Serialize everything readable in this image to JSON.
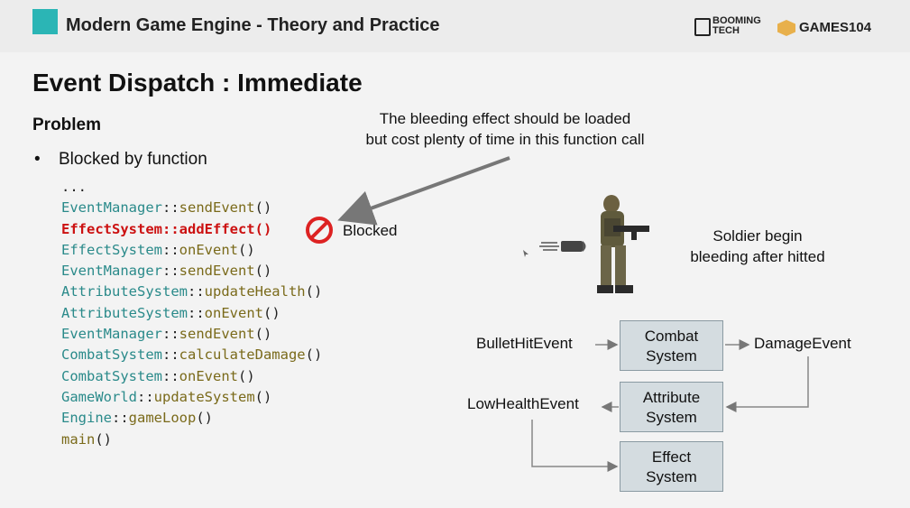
{
  "header": {
    "title": "Modern Game Engine - Theory and Practice",
    "brand_booming": "BOOMING TECH",
    "brand_games": "GAMES104"
  },
  "slide": {
    "title": "Event Dispatch : Immediate",
    "section": "Problem",
    "bullet_marker": "•",
    "bullet_text": "Blocked by function"
  },
  "code": {
    "ellipsis": "...",
    "lines": [
      {
        "cls": "EventManager",
        "sep": "::",
        "fn": "sendEvent",
        "args": "()",
        "highlight": false
      },
      {
        "cls": "EffectSystem",
        "sep": "::",
        "fn": "addEffect",
        "args": "()",
        "highlight": true
      },
      {
        "cls": "EffectSystem",
        "sep": "::",
        "fn": "onEvent",
        "args": "()",
        "highlight": false
      },
      {
        "cls": "EventManager",
        "sep": "::",
        "fn": "sendEvent",
        "args": "()",
        "highlight": false
      },
      {
        "cls": "AttributeSystem",
        "sep": "::",
        "fn": "updateHealth",
        "args": "()",
        "highlight": false
      },
      {
        "cls": "AttributeSystem",
        "sep": "::",
        "fn": "onEvent",
        "args": "()",
        "highlight": false
      },
      {
        "cls": "EventManager",
        "sep": "::",
        "fn": "sendEvent",
        "args": "()",
        "highlight": false
      },
      {
        "cls": "CombatSystem",
        "sep": "::",
        "fn": "calculateDamage",
        "args": "()",
        "highlight": false
      },
      {
        "cls": "CombatSystem",
        "sep": "::",
        "fn": "onEvent",
        "args": "()",
        "highlight": false
      },
      {
        "cls": "GameWorld",
        "sep": "::",
        "fn": "updateSystem",
        "args": "()",
        "highlight": false
      },
      {
        "cls": "Engine",
        "sep": "::",
        "fn": "gameLoop",
        "args": "()",
        "highlight": false
      },
      {
        "cls": "",
        "sep": "",
        "fn": "main",
        "args": "()",
        "highlight": false
      }
    ]
  },
  "blocked_label": "Blocked",
  "callout": {
    "line1": "The bleeding effect should be loaded",
    "line2": "but cost plenty of time in this function call"
  },
  "soldier_caption": {
    "line1": "Soldier begin",
    "line2": "bleeding after hitted"
  },
  "diagram": {
    "events": {
      "hit": "BulletHitEvent",
      "damage": "DamageEvent",
      "low_health": "LowHealthEvent"
    },
    "systems": {
      "combat": {
        "line1": "Combat",
        "line2": "System"
      },
      "attribute": {
        "line1": "Attribute",
        "line2": "System"
      },
      "effect": {
        "line1": "Effect",
        "line2": "System"
      }
    }
  },
  "colors": {
    "highlight": "#cc1111",
    "class_name": "#2a8a8a",
    "function_name": "#7a6a1a",
    "system_box": "#d4dce0",
    "logo": "#2bb5b5"
  }
}
